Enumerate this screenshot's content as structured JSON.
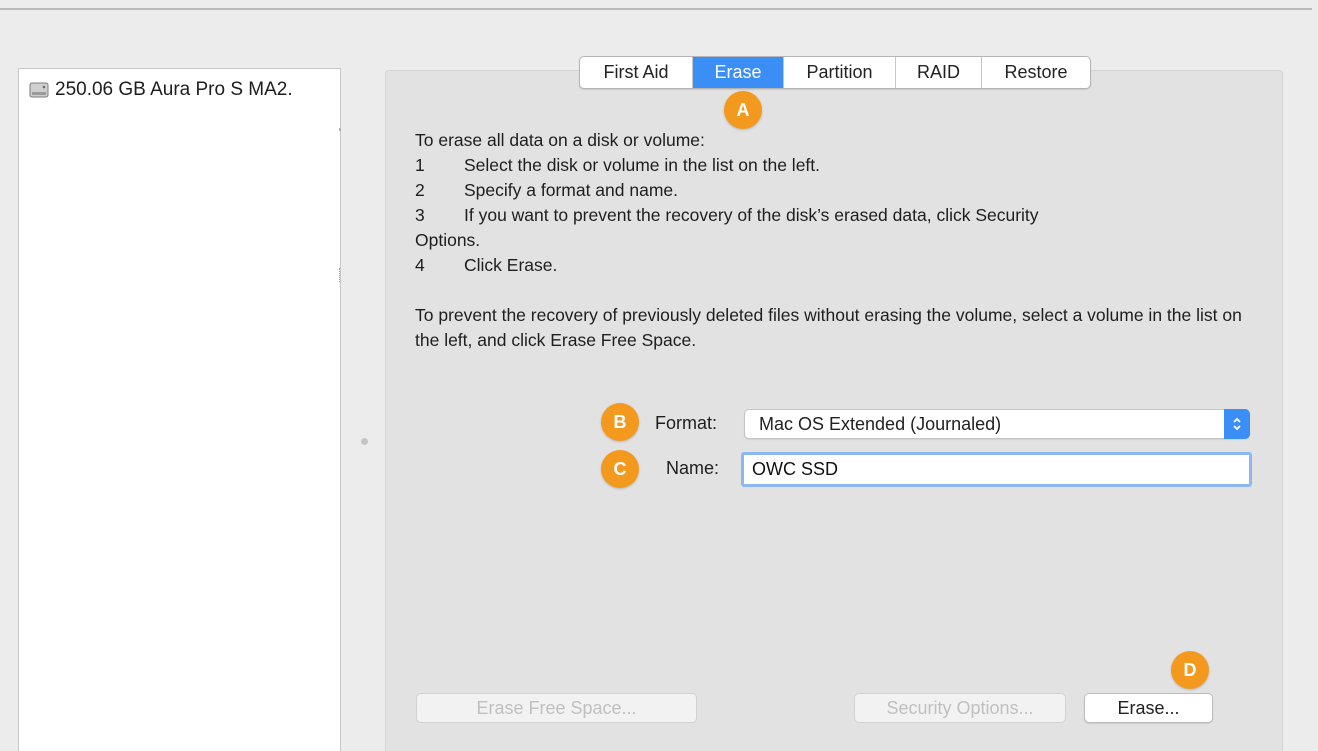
{
  "sidebar": {
    "disk_label": "250.06 GB Aura Pro S MA2.",
    "disk_icon": "hard-drive-icon"
  },
  "tabs": [
    {
      "label": "First Aid",
      "active": false
    },
    {
      "label": "Erase",
      "active": true
    },
    {
      "label": "Partition",
      "active": false
    },
    {
      "label": "RAID",
      "active": false
    },
    {
      "label": "Restore",
      "active": false
    }
  ],
  "callouts": {
    "a": "A",
    "b": "B",
    "c": "C",
    "d": "D"
  },
  "instructions": {
    "intro": "To erase all data on a disk or volume:",
    "steps": [
      {
        "num": "1",
        "text": "Select the disk or volume in the list on the left."
      },
      {
        "num": "2",
        "text": "Specify a format and name."
      },
      {
        "num": "3",
        "text": "If you want to prevent the recovery of the disk’s erased data, click Security"
      },
      {
        "num": "",
        "text": "Options."
      },
      {
        "num": "4",
        "text": "Click Erase."
      }
    ],
    "free_space_note": "To prevent the recovery of previously deleted files without erasing the volume, select a volume in the list on the left, and click Erase Free Space."
  },
  "form": {
    "format_label": "Format:",
    "format_value": "Mac OS Extended (Journaled)",
    "name_label": "Name:",
    "name_value": "OWC SSD"
  },
  "buttons": {
    "erase_free_space": "Erase Free Space...",
    "security_options": "Security Options...",
    "erase": "Erase..."
  },
  "colors": {
    "accent": "#3b8ef5",
    "callout": "#f39a1e"
  }
}
